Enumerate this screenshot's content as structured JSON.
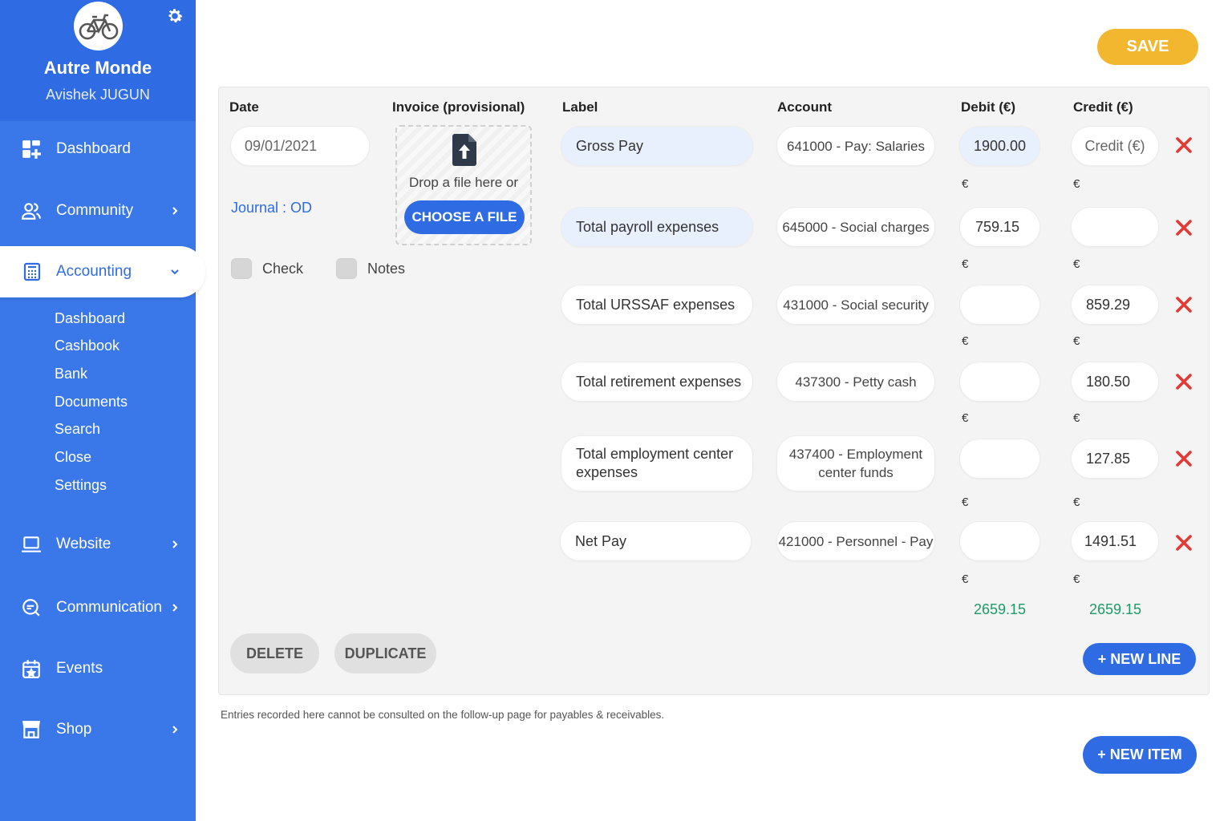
{
  "sidebar": {
    "org_name": "Autre Monde",
    "user_name": "Avishek JUGUN",
    "nav": [
      {
        "label": "Dashboard",
        "icon": "dashboard-icon"
      },
      {
        "label": "Community",
        "icon": "community-icon"
      },
      {
        "label": "Accounting",
        "icon": "calculator-icon"
      },
      {
        "label": "Website",
        "icon": "laptop-icon"
      },
      {
        "label": "Communication",
        "icon": "chat-icon"
      },
      {
        "label": "Events",
        "icon": "calendar-icon"
      },
      {
        "label": "Shop",
        "icon": "shop-icon"
      }
    ],
    "accounting_sub": [
      "Dashboard",
      "Cashbook",
      "Bank",
      "Documents",
      "Search",
      "Close",
      "Settings"
    ]
  },
  "toolbar": {
    "save_label": "SAVE"
  },
  "form": {
    "headers": {
      "date": "Date",
      "invoice": "Invoice (provisional)",
      "label": "Label",
      "account": "Account",
      "debit": "Debit (€)",
      "credit": "Credit (€)"
    },
    "date_value": "09/01/2021",
    "journal": "Journal : OD",
    "drop_text": "Drop a file here or",
    "choose_file": "CHOOSE A FILE",
    "check_label": "Check",
    "notes_label": "Notes",
    "euro": "€",
    "credit_placeholder": "Credit (€)",
    "lines": [
      {
        "label": "Gross Pay",
        "account": "641000 - Pay: Salaries",
        "debit": "1900.00",
        "credit": ""
      },
      {
        "label": "Total payroll expenses",
        "account": "645000 - Social charges",
        "debit": "759.15",
        "credit": ""
      },
      {
        "label": "Total URSSAF expenses",
        "account": "431000 - Social security",
        "debit": "",
        "credit": "859.29"
      },
      {
        "label": "Total retirement expenses",
        "account": "437300 - Petty cash",
        "debit": "",
        "credit": "180.50"
      },
      {
        "label": "Total employment center expenses",
        "account": "437400 - Employment center funds",
        "debit": "",
        "credit": "127.85"
      },
      {
        "label": "Net Pay",
        "account": "421000 - Personnel - Pay",
        "debit": "",
        "credit": "1491.51"
      }
    ],
    "total_debit": "2659.15",
    "total_credit": "2659.15",
    "delete_label": "DELETE",
    "duplicate_label": "DUPLICATE",
    "new_line_label": "+ NEW LINE"
  },
  "footnote": "Entries recorded here cannot be consulted on the follow-up page for payables & receivables.",
  "new_item_label": "+ NEW ITEM",
  "colors": {
    "primary": "#2f6be3",
    "sidebar": "#3a77e8",
    "save": "#f3b72f",
    "total": "#1e9b6b",
    "delete": "#e53935"
  }
}
